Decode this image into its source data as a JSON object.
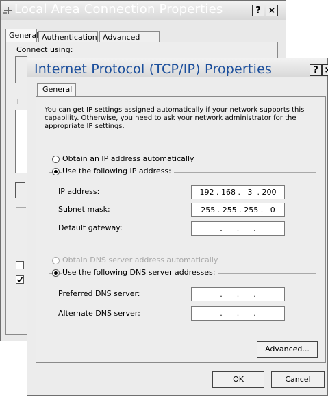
{
  "back_window": {
    "title": "Local Area Connection Properties",
    "help_label": "?",
    "close_label": "×",
    "tabs": [
      "General",
      "Authentication",
      "Advanced"
    ],
    "connect_using_label": "Connect using:",
    "partial_t": "T"
  },
  "dialog": {
    "title": "Internet Protocol (TCP/IP) Properties",
    "help_label": "?",
    "close_label": "×",
    "tab_general": "General",
    "description": "You can get IP settings assigned automatically if your network supports this capability. Otherwise, you need to ask your network administrator for the appropriate IP settings.",
    "ip_auto_label": "Obtain an IP address automatically",
    "ip_manual_label": "Use the following IP address:",
    "ip_address_label": "IP address:",
    "ip_address_value": "192 . 168 .   3  . 200",
    "subnet_label": "Subnet mask:",
    "subnet_value": "255 . 255 . 255 .   0",
    "gateway_label": "Default gateway:",
    "gateway_value": "  .      .      .  ",
    "dns_auto_label": "Obtain DNS server address automatically",
    "dns_manual_label": "Use the following DNS server addresses:",
    "preferred_dns_label": "Preferred DNS server:",
    "preferred_dns_value": "  .      .      .  ",
    "alternate_dns_label": "Alternate DNS server:",
    "alternate_dns_value": "  .      .      .  ",
    "advanced_button": "Advanced...",
    "ok_button": "OK",
    "cancel_button": "Cancel"
  }
}
